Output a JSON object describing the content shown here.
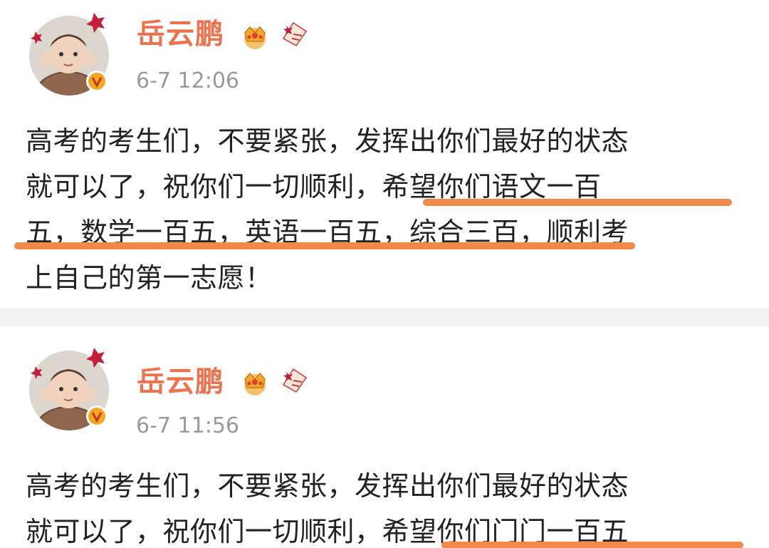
{
  "posts": [
    {
      "username": "岳云鹏",
      "timestamp": "6-7 12:06",
      "body_lines": [
        "高考的考生们，不要紧张，发挥出你们最好的状态",
        "就可以了，祝你们一切顺利，希望你们语文一百",
        "五，数学一百五，英语一百五，综合三百，顺利考",
        "上自己的第一志愿！"
      ]
    },
    {
      "username": "岳云鹏",
      "timestamp": "6-7 11:56",
      "body_lines": [
        "高考的考生们，不要紧张，发挥出你们最好的状态",
        "就可以了，祝你们一切顺利，希望你们门门一百五"
      ]
    }
  ],
  "icons": {
    "avatar": "baby-avatar",
    "verified": "verified-v-icon",
    "crown": "crown-icon",
    "scroll": "scroll-badge-icon"
  },
  "colors": {
    "username": "#eb7350",
    "timestamp": "#9a9a9a",
    "body": "#222222",
    "highlight_underline": "#f08a4a",
    "verified_badge": "#f5a623",
    "separator": "#f2f2f2"
  }
}
